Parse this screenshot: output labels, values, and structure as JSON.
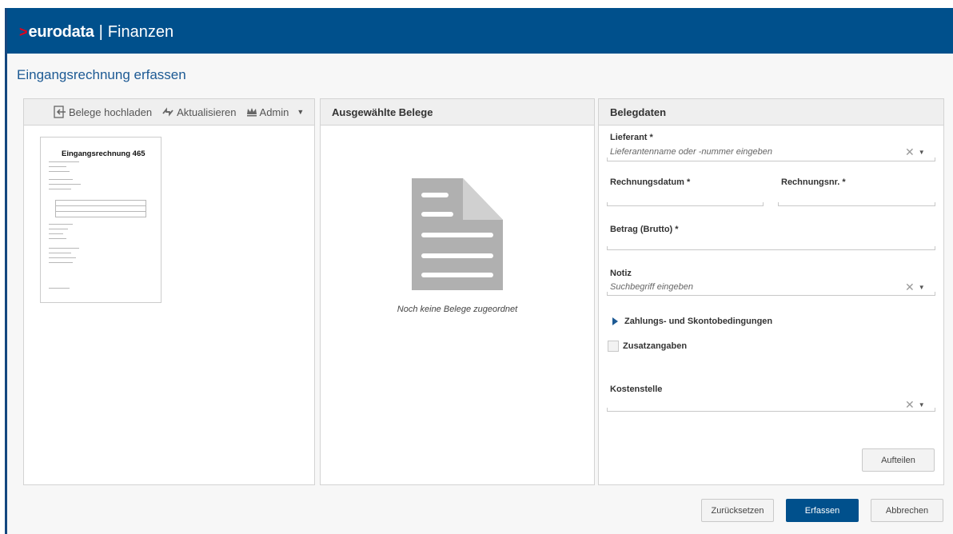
{
  "header": {
    "brand_chevron": ">",
    "brand": "eurodata",
    "separator": "|",
    "app_name": "Finanzen"
  },
  "page": {
    "title": "Eingangsrechnung erfassen"
  },
  "toolbar": {
    "upload_label": "Belege hochladen",
    "refresh_label": "Aktualisieren",
    "admin_label": "Admin"
  },
  "document_preview": {
    "title": "Eingangsrechnung 465"
  },
  "selected_panel": {
    "title": "Ausgewählte Belege",
    "empty_message": "Noch keine Belege zugeordnet"
  },
  "belegdaten": {
    "title": "Belegdaten",
    "lieferant": {
      "label": "Lieferant *",
      "placeholder": "Lieferantenname oder -nummer eingeben"
    },
    "rechnungsdatum": {
      "label": "Rechnungsdatum *"
    },
    "rechnungsnr": {
      "label": "Rechnungsnr. *"
    },
    "betrag": {
      "label": "Betrag (Brutto) *"
    },
    "notiz": {
      "label": "Notiz",
      "placeholder": "Suchbegriff eingeben"
    },
    "zahlungs_label": "Zahlungs- und Skontobedingungen",
    "zusatz_label": "Zusatzangaben",
    "kostenstelle": {
      "label": "Kostenstelle"
    },
    "aufteilen_label": "Aufteilen"
  },
  "actions": {
    "reset_label": "Zurücksetzen",
    "submit_label": "Erfassen",
    "cancel_label": "Abbrechen"
  },
  "colors": {
    "header_bg": "#00508c",
    "accent": "#1d5a94",
    "logo_chevron": "#e2001a"
  },
  "icons": {
    "upload": "upload-icon",
    "refresh": "refresh-icon",
    "admin": "crown-icon",
    "document": "document-icon",
    "clear": "clear-icon",
    "dropdown": "chevron-down-icon"
  }
}
